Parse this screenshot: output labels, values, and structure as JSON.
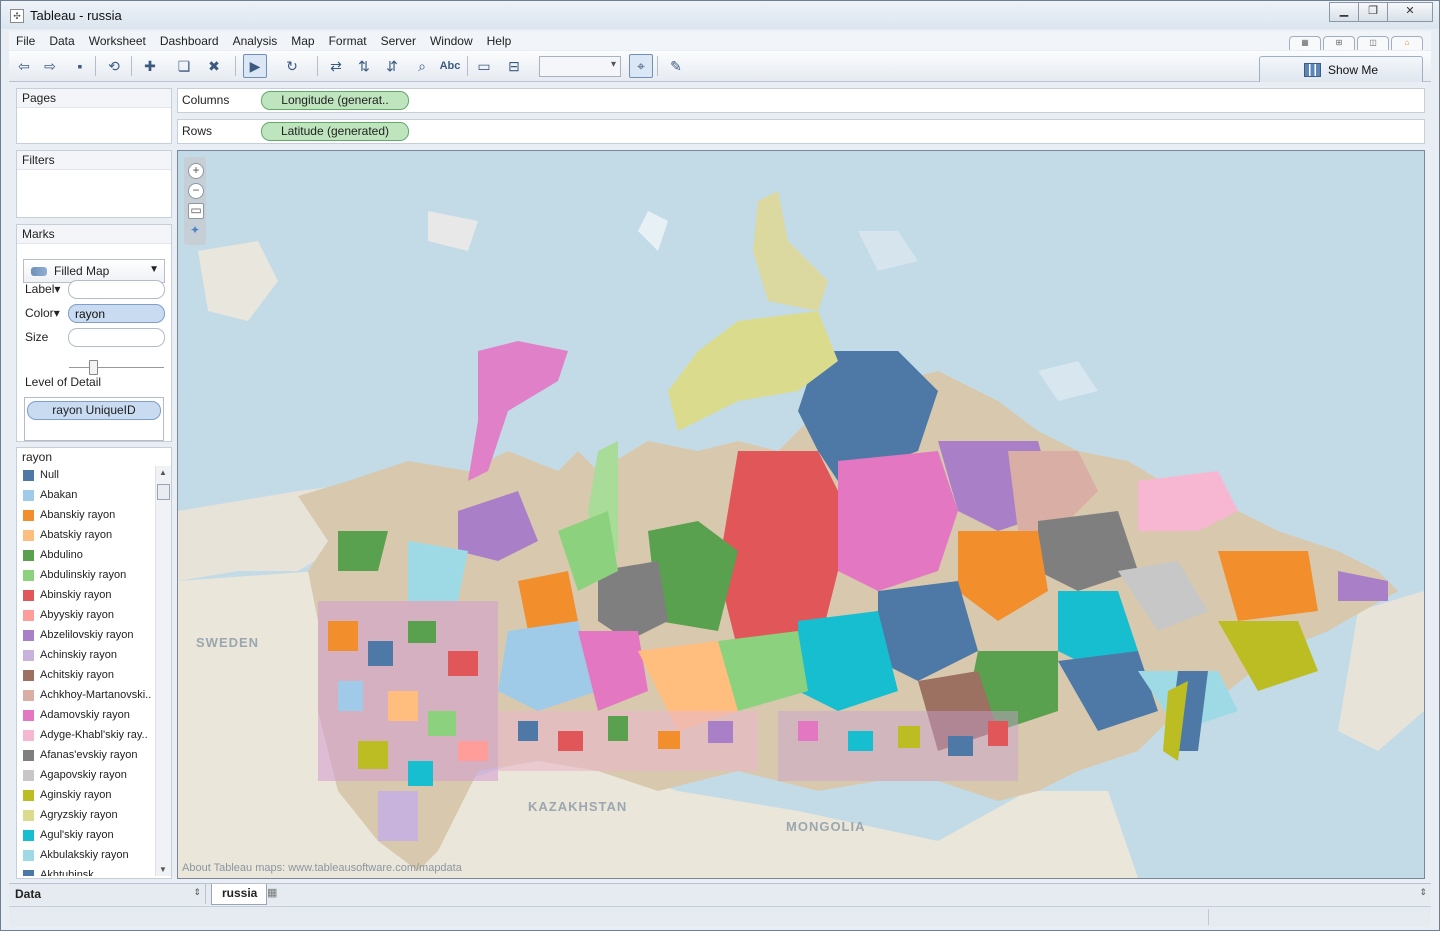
{
  "window": {
    "title": "Tableau - russia"
  },
  "menu": [
    "File",
    "Data",
    "Worksheet",
    "Dashboard",
    "Analysis",
    "Map",
    "Format",
    "Server",
    "Window",
    "Help"
  ],
  "toolbar": {
    "text_button": "Abc",
    "show_me": "Show Me"
  },
  "cards": {
    "pages": "Pages",
    "filters": "Filters",
    "marks": "Marks"
  },
  "marks": {
    "type": "Filled Map",
    "label": "Label",
    "color": "Color",
    "size": "Size",
    "color_field": "rayon",
    "level_of_detail": "Level of Detail",
    "lod_field": "rayon UniqueID"
  },
  "shelves": {
    "columns_label": "Columns",
    "columns_field": "Longitude (generat..",
    "rows_label": "Rows",
    "rows_field": "Latitude (generated)"
  },
  "legend": {
    "title": "rayon",
    "items": [
      {
        "label": "Null",
        "color": "#4e79a7"
      },
      {
        "label": "Abakan",
        "color": "#a0cbe8"
      },
      {
        "label": "Abanskiy rayon",
        "color": "#f28e2b"
      },
      {
        "label": "Abatskiy rayon",
        "color": "#ffbe7d"
      },
      {
        "label": "Abdulino",
        "color": "#59a14f"
      },
      {
        "label": "Abdulinskiy rayon",
        "color": "#8cd17d"
      },
      {
        "label": "Abinskiy rayon",
        "color": "#e15759"
      },
      {
        "label": "Abyyskiy rayon",
        "color": "#ff9d9a"
      },
      {
        "label": "Abzelilovskiy rayon",
        "color": "#a97fc7"
      },
      {
        "label": "Achinskiy rayon",
        "color": "#c8b3dc"
      },
      {
        "label": "Achitskiy rayon",
        "color": "#9c7162"
      },
      {
        "label": "Achkhoy-Martanovski..",
        "color": "#d9aea5"
      },
      {
        "label": "Adamovskiy rayon",
        "color": "#e377c2"
      },
      {
        "label": "Adyge-Khabl'skiy ray..",
        "color": "#f7b6d2"
      },
      {
        "label": "Afanas'evskiy rayon",
        "color": "#7f7f7f"
      },
      {
        "label": "Agapovskiy rayon",
        "color": "#c7c7c7"
      },
      {
        "label": "Aginskiy rayon",
        "color": "#bcbd22"
      },
      {
        "label": "Agryzskiy rayon",
        "color": "#dbdb8d"
      },
      {
        "label": "Agul'skiy rayon",
        "color": "#17becf"
      },
      {
        "label": "Akbulakskiy rayon",
        "color": "#9edae5"
      },
      {
        "label": "Akhtubinsk",
        "color": "#4e79a7"
      }
    ]
  },
  "map": {
    "labels": [
      "SWEDEN",
      "KAZAKHSTAN",
      "MONGOLIA"
    ],
    "attribution": "About Tableau maps: www.tableausoftware.com/mapdata"
  },
  "bottom": {
    "data_tab": "Data",
    "sheet_tab": "russia"
  }
}
